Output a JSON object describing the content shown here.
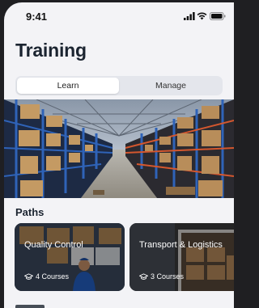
{
  "status": {
    "time": "9:41"
  },
  "page": {
    "title": "Training"
  },
  "tabs": {
    "learn": "Learn",
    "manage": "Manage"
  },
  "paths": {
    "heading": "Paths",
    "cards": [
      {
        "title": "Quality Control",
        "count": "4 Courses"
      },
      {
        "title": "Transport & Logistics",
        "count": "3 Courses"
      }
    ]
  },
  "colors": {
    "accent": "#1b2430",
    "background": "#f3f3f6",
    "segment": "#e4e6ec"
  }
}
